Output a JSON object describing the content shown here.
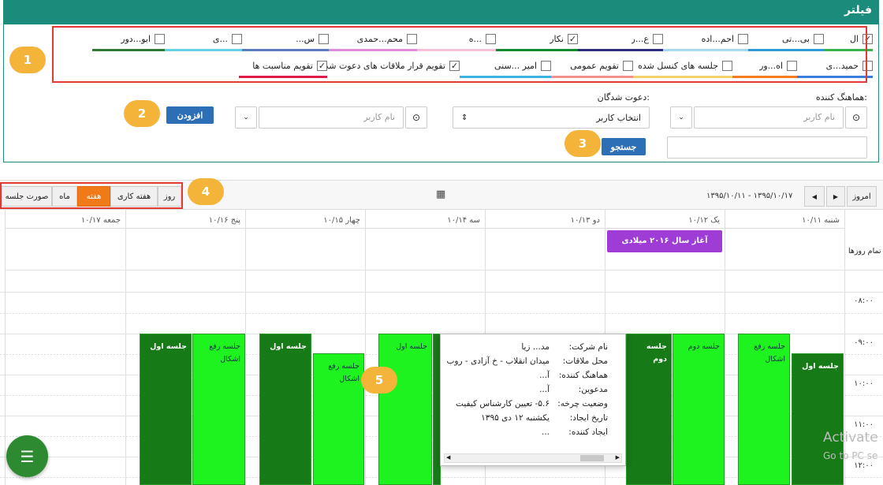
{
  "filter": {
    "title": "فیلتر",
    "row1": [
      {
        "label": "ال",
        "checked": true,
        "color": "#3bb34a"
      },
      {
        "label": "بی...تی",
        "checked": false,
        "color": "#2e9bd6"
      },
      {
        "label": "احم...اده",
        "checked": false,
        "color": "#a7d9f0"
      },
      {
        "label": "ع...ر",
        "checked": false,
        "color": "#2f2e7d"
      },
      {
        "label": "نکار",
        "checked": true,
        "color": "#118a30"
      },
      {
        "label": "...ه",
        "checked": false,
        "color": "#f6c1d6"
      },
      {
        "label": "محم...حمدی",
        "checked": false,
        "color": "#e08ae0"
      },
      {
        "label": "س...",
        "checked": false,
        "color": "#5b7dbb"
      },
      {
        "label": "...ی",
        "checked": false,
        "color": "#66d0e8"
      },
      {
        "label": "ابو...دور",
        "checked": false,
        "color": "#2f7a35"
      }
    ],
    "row2": [
      {
        "label": "حمید...ی",
        "checked": false,
        "color": "#3b7ddd"
      },
      {
        "label": "اه...ور",
        "checked": false,
        "color": "#f37c20"
      },
      {
        "label": "جلسه های کنسل شده",
        "checked": false,
        "color": "#f2d36b"
      },
      {
        "label": "تقویم عمومی",
        "checked": false,
        "color": "#f59090"
      },
      {
        "label": "امیر ...سنی",
        "checked": false,
        "color": "#3bb3e0"
      },
      {
        "label": "تقویم قرار ملاقات های دعوت شده",
        "checked": true,
        "color": "#ffffff"
      },
      {
        "label": "تقویم مناسبت ها",
        "checked": true,
        "color": "#e0194a"
      }
    ],
    "coordinator_label": "هماهنگ کننده:",
    "invitees_label": "دعوت شدگان:",
    "username_placeholder": "نام کاربر",
    "select_user": "انتخاب کاربر",
    "add_button": "افزودن",
    "search_button": "جستجو"
  },
  "callouts": [
    "1",
    "2",
    "3",
    "4",
    "5"
  ],
  "toolbar": {
    "today": "امروز",
    "date_range": "۱۳۹۵/۱۰/۱۱ - ۱۳۹۵/۱۰/۱۷",
    "views": [
      "روز",
      "هفته کاری",
      "هفته",
      "ماه",
      "صورت جلسه"
    ],
    "active_view": "هفته"
  },
  "calendar": {
    "days": [
      "شنبه ۱۰/۱۱",
      "یک ۱۰/۱۲",
      "دو ۱۰/۱۳",
      "سه ۱۰/۱۴",
      "چهار ۱۰/۱۵",
      "پنج ۱۰/۱۶",
      "جمعه ۱۰/۱۷"
    ],
    "all_day_label": "تمام روزها",
    "times": [
      "۰۸:۰۰",
      "۰۹:۰۰",
      "۱۰:۰۰",
      "۱۱:۰۰",
      "۱۲:۰۰"
    ],
    "all_day_event": "آغاز سال ۲۰۱۶ میلادی",
    "events": [
      {
        "title": "جلسه اول"
      },
      {
        "title": "جلسه رفع اشکال"
      },
      {
        "title": "جلسه دوم"
      },
      {
        "title": "جلسه دوم"
      },
      {
        "title": "جلسه اول"
      },
      {
        "title": "جلسه رفع اشکال"
      },
      {
        "title": "جلسه اول"
      },
      {
        "title": "جلسه رفع اشکال"
      },
      {
        "title": "جلسه اول"
      },
      {
        "title": "جلسه رفع اشکال"
      }
    ]
  },
  "popup": {
    "rows": [
      {
        "key": "نام شرکت:",
        "value": "مد... زیا"
      },
      {
        "key": "محل ملاقات:",
        "value": "میدان انقلاب - خ آزادی - روب"
      },
      {
        "key": "هماهنگ کننده:",
        "value": "آ..."
      },
      {
        "key": "مدعوین:",
        "value": "آ..."
      },
      {
        "key": "وضعیت چرخه:",
        "value": "۵.۶- تعیین کارشناس کیفیت"
      },
      {
        "key": "تاریخ ایجاد:",
        "value": "یکشنبه ۱۲ دی ۱۳۹۵"
      },
      {
        "key": "ایجاد کننده:",
        "value": "..."
      }
    ]
  },
  "watermark": {
    "title": "Activate",
    "subtitle": "Go to PC se"
  }
}
